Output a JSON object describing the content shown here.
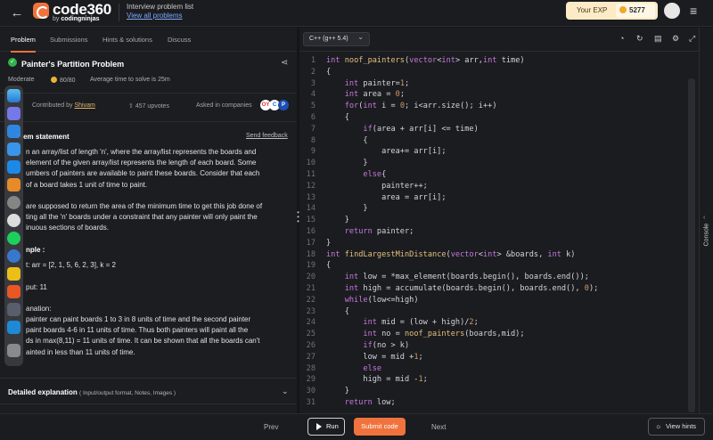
{
  "topbar": {
    "back_icon": "arrow-left-icon",
    "logo_text": "code360",
    "logo_sub_prefix": "by ",
    "logo_sub_brand": "codingninjas",
    "breadcrumb_title": "Interview problem list",
    "breadcrumb_link": "View all problems",
    "exp_label": "Your EXP",
    "exp_value": "5277"
  },
  "left_tabs": [
    "Problem",
    "Submissions",
    "Hints & solutions",
    "Discuss"
  ],
  "problem": {
    "title": "Painter's Partition Problem",
    "difficulty": "Moderate",
    "score": "80/80",
    "avg_time": "Average time to solve is 25m",
    "contributed_prefix": "Contributed by ",
    "contributor": "Shivam",
    "upvotes": "457 upvotes",
    "asked_in": "Asked in companies",
    "companies": [
      "OY",
      "C",
      "P"
    ]
  },
  "statement": {
    "heading": "blem statement",
    "feedback": "Send feedback",
    "para1": [
      "n an array/list of length 'n', where the array/list represents the boards and",
      "element of the given array/list represents the length of each board. Some",
      "umbers of painters are available to paint these boards. Consider that each",
      "of a board takes 1 unit of time to paint."
    ],
    "para2": [
      "are supposed to return the area of the minimum time to get this job done of",
      "ting all the 'n' boards under a constraint that any painter will only paint the",
      "inuous sections of boards."
    ],
    "example_heading": "nple :",
    "example_input": "t: arr = [2, 1, 5, 6, 2, 3], k = 2",
    "example_output": "put: 11",
    "explanation_heading": "anation:",
    "explanation": [
      "painter can paint boards 1 to 3 in 8 units of time and the second painter",
      "paint boards 4-6 in 11 units of time. Thus both painters will paint all the",
      "ds in max(8,11) = 11 units of time. It can be shown that all the boards can't",
      "ainted in less than 11 units of time."
    ]
  },
  "detailed": {
    "label": "Detailed explanation",
    "sub": "( Input/output format, Notes, Images )"
  },
  "editor": {
    "language": "C++ (g++ 5.4)",
    "line_numbers": [
      "1",
      "2",
      "3",
      "4",
      "5",
      "6",
      "7",
      "8",
      "9",
      "10",
      "11",
      "12",
      "13",
      "14",
      "15",
      "16",
      "17",
      "18",
      "19",
      "20",
      "21",
      "22",
      "23",
      "24",
      "25",
      "26",
      "27",
      "28",
      "29",
      "30",
      "31"
    ],
    "lines": [
      "int noof_painters(vector<int> arr,int time)",
      "{",
      "    int painter=1;",
      "    int area = 0;",
      "    for(int i = 0; i<arr.size(); i++)",
      "    {",
      "        if(area + arr[i] <= time)",
      "        {",
      "            area+= arr[i];",
      "        }",
      "        else{",
      "            painter++;",
      "            area = arr[i];",
      "        }",
      "    }",
      "    return painter;",
      "}",
      "int findLargestMinDistance(vector<int> &boards, int k)",
      "{",
      "    int low = *max_element(boards.begin(), boards.end());",
      "    int high = accumulate(boards.begin(), boards.end(), 0);",
      "    while(low<=high)",
      "    {",
      "        int mid = (low + high)/2;",
      "        int no = noof_painters(boards,mid);",
      "        if(no > k)",
      "        low = mid +1;",
      "        else",
      "        high = mid -1;",
      "    }",
      "    return low;"
    ]
  },
  "console_label": "Console",
  "bottom": {
    "prev": "Prev",
    "run": "Run",
    "submit": "Submit code",
    "next": "Next",
    "hints": "View hints"
  },
  "colors": {
    "accent": "#f0733d",
    "success": "#2fb34a",
    "keyword": "#c678dd",
    "number": "#d19a66"
  }
}
